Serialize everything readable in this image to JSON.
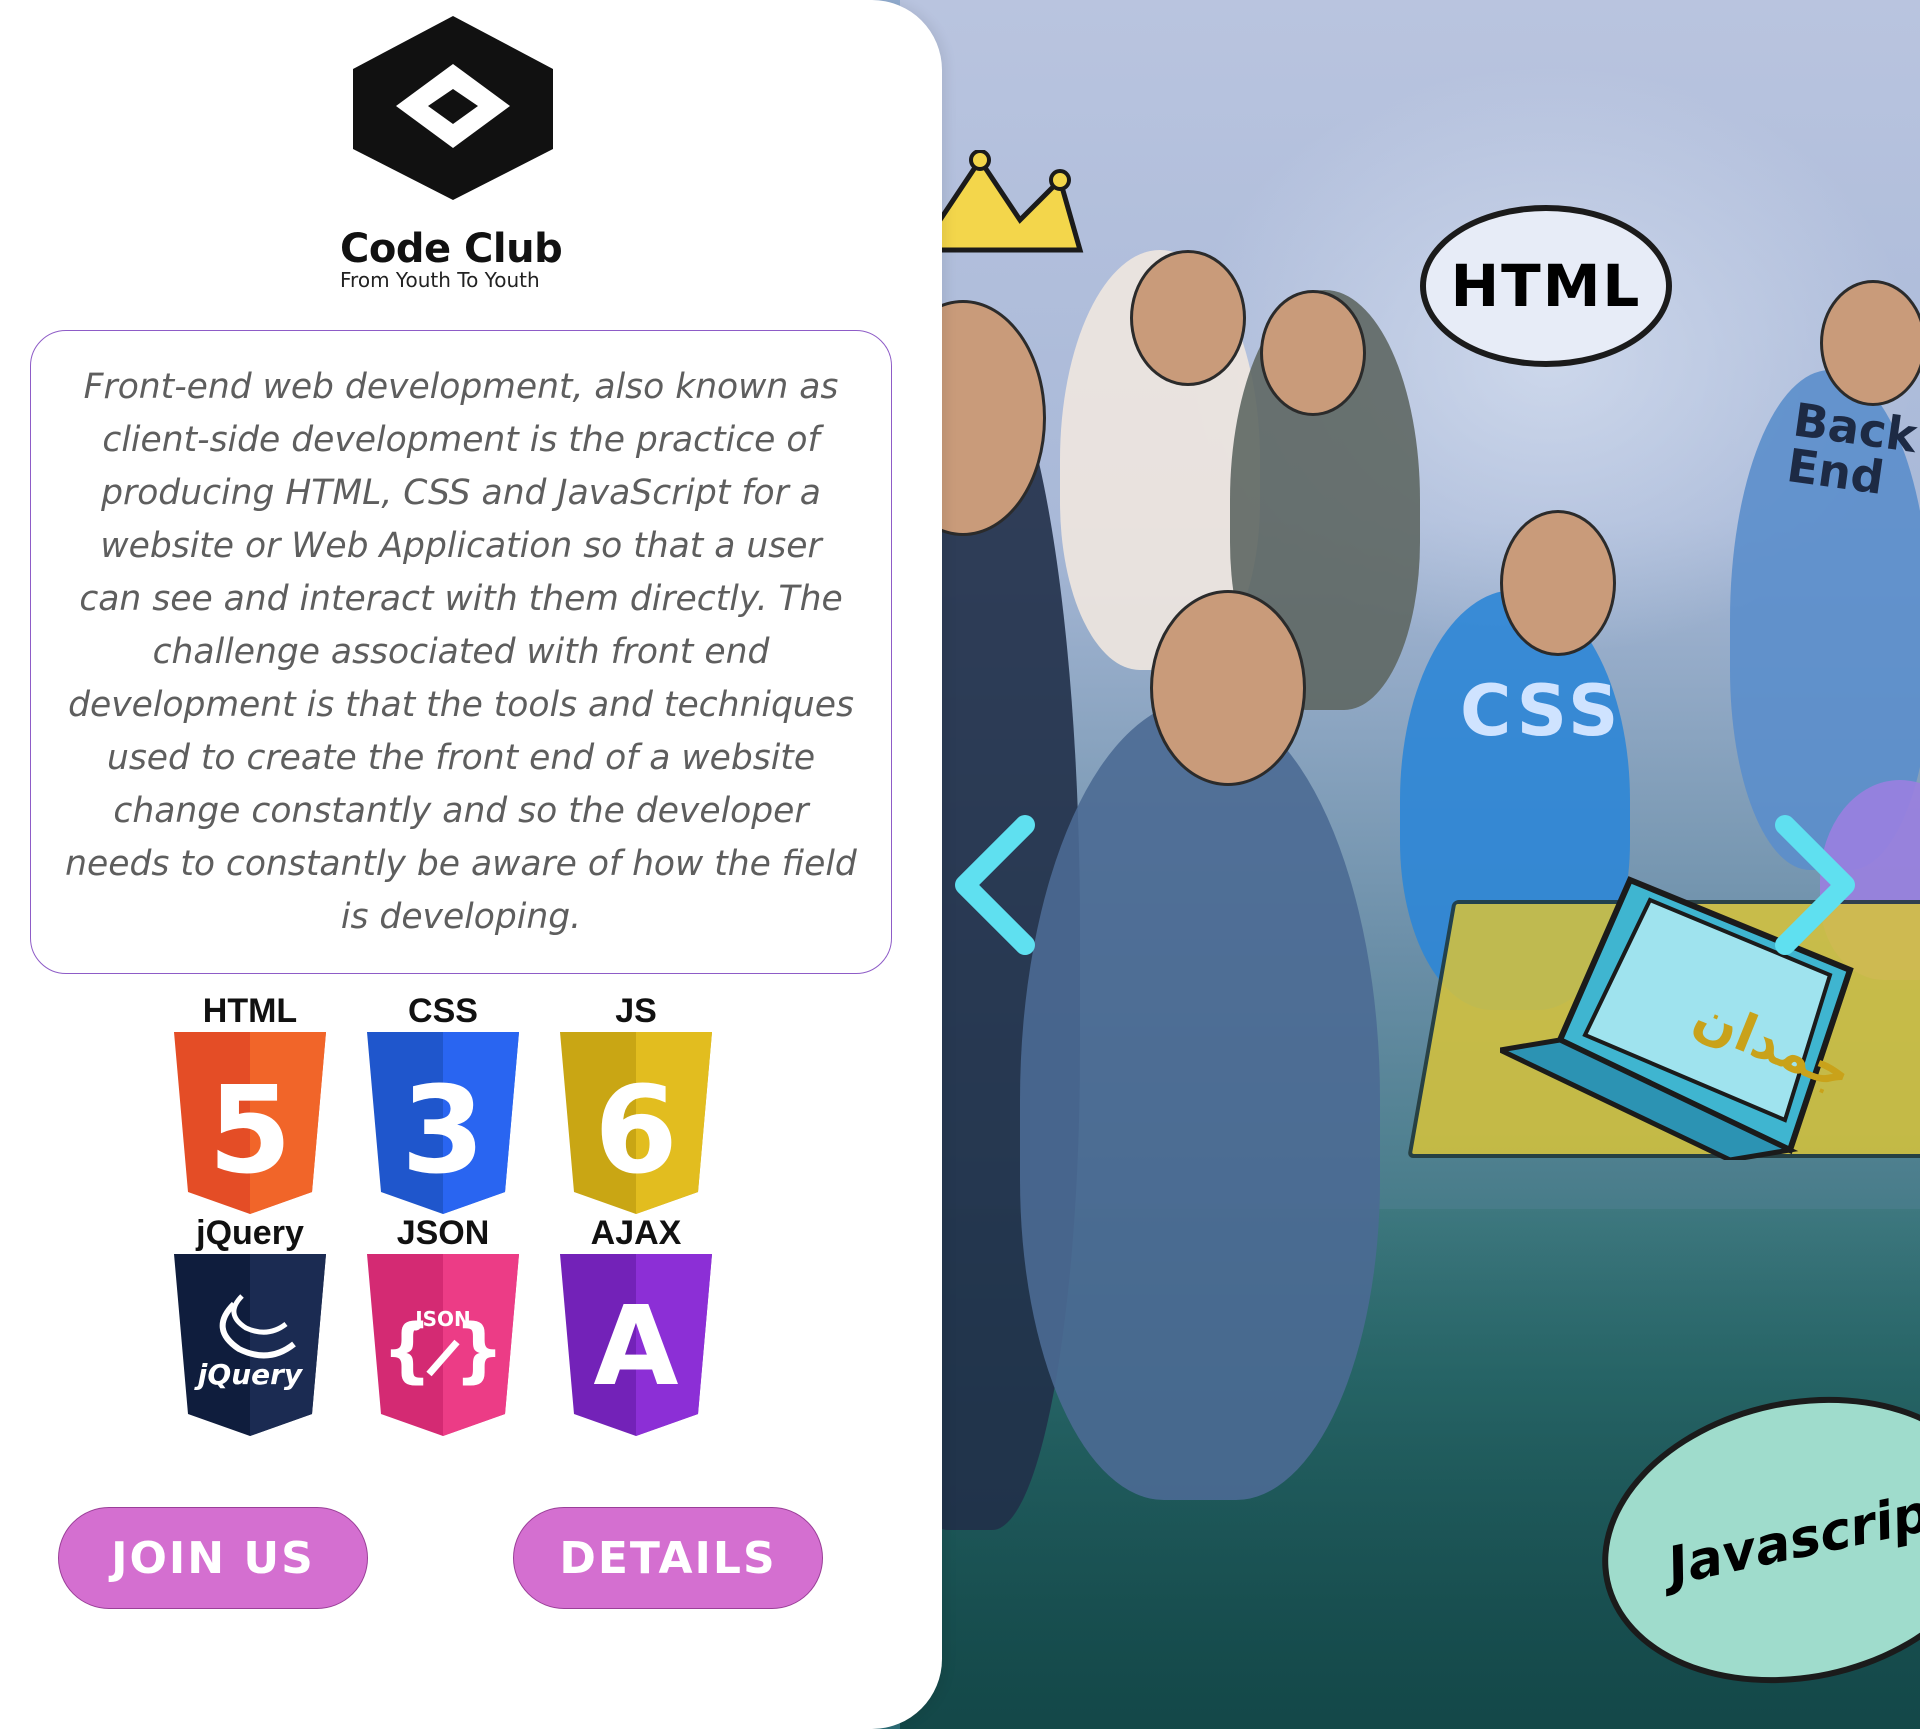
{
  "brand": {
    "name": "Code Club",
    "tagline": "From Youth To Youth"
  },
  "description": "Front-end web development, also known as client-side development is the practice of producing HTML, CSS and JavaScript for a website or Web Application so that a user can see and interact with them directly. The challenge associated with front end development is that the tools and techniques used to create the front end of a website change constantly and so the developer needs to constantly be aware of how the field is developing.",
  "technologies": [
    {
      "label": "HTML",
      "glyph": "5",
      "color": "#e44d26",
      "dark": "#c8401f"
    },
    {
      "label": "CSS",
      "glyph": "3",
      "color": "#2965f1",
      "dark": "#1f56cc"
    },
    {
      "label": "JS",
      "glyph": "6",
      "color": "#e2bd1f",
      "dark": "#c9a614"
    },
    {
      "label": "jQuery",
      "glyph": "jQuery",
      "color": "#1b2b52",
      "dark": "#0f1d3d"
    },
    {
      "label": "JSON",
      "glyph": "JSON",
      "color": "#ec3c86",
      "dark": "#d42a73"
    },
    {
      "label": "AJAX",
      "glyph": "A",
      "color": "#8c2fd6",
      "dark": "#7322b8"
    }
  ],
  "buttons": {
    "join": "JOIN US",
    "details": "DETAILS"
  },
  "hero": {
    "bubble_html": "HTML",
    "shirt_css": "CSS",
    "shirt_back": "Back End",
    "bubble_js": "Javascript",
    "laptop_text": "جمدان"
  },
  "colors": {
    "accent_button": "#d46fd0",
    "box_border": "#8e5cc7",
    "arrow": "#5fe0f0"
  }
}
